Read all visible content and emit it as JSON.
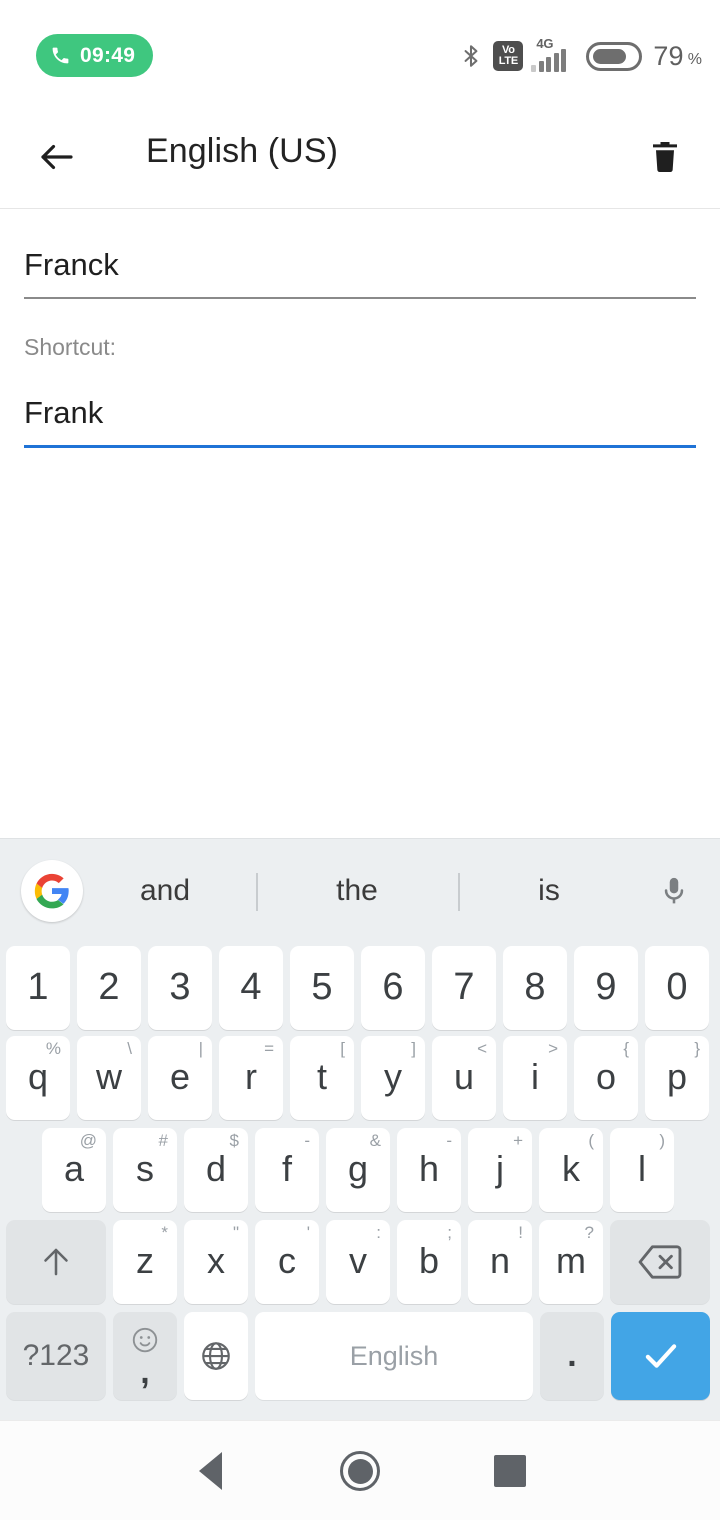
{
  "status_bar": {
    "call_pill": {
      "icon": "phone-icon",
      "time": "09:49",
      "color": "#3fc77f"
    },
    "bluetooth_icon": "bluetooth-icon",
    "volte": {
      "line1": "Vo",
      "line2": "LTE"
    },
    "network": {
      "type": "4G",
      "bars_filled": 4,
      "bars_total": 5
    },
    "battery": {
      "level": "79",
      "unit": "%",
      "fill_percent": 75
    }
  },
  "app_bar": {
    "back_icon": "back-arrow-icon",
    "title": "English (US)",
    "delete_icon": "trash-icon"
  },
  "form": {
    "word": {
      "value": "Franck",
      "focused": false
    },
    "shortcut_label": "Shortcut:",
    "shortcut": {
      "value": "Frank",
      "focused": true
    },
    "focus_color": "#1f73d6",
    "idle_color": "#8a8a8a"
  },
  "keyboard": {
    "suggestions": {
      "logo": "google-g-icon",
      "items": [
        "and",
        "the",
        "is"
      ],
      "mic_icon": "microphone-icon"
    },
    "rows": {
      "numbers": [
        {
          "key": "1"
        },
        {
          "key": "2"
        },
        {
          "key": "3"
        },
        {
          "key": "4"
        },
        {
          "key": "5"
        },
        {
          "key": "6"
        },
        {
          "key": "7"
        },
        {
          "key": "8"
        },
        {
          "key": "9"
        },
        {
          "key": "0"
        }
      ],
      "top": [
        {
          "key": "q",
          "hint": "%"
        },
        {
          "key": "w",
          "hint": "\\"
        },
        {
          "key": "e",
          "hint": "|"
        },
        {
          "key": "r",
          "hint": "="
        },
        {
          "key": "t",
          "hint": "["
        },
        {
          "key": "y",
          "hint": "]"
        },
        {
          "key": "u",
          "hint": "<"
        },
        {
          "key": "i",
          "hint": ">"
        },
        {
          "key": "o",
          "hint": "{"
        },
        {
          "key": "p",
          "hint": "}"
        }
      ],
      "home": [
        {
          "key": "a",
          "hint": "@"
        },
        {
          "key": "s",
          "hint": "#"
        },
        {
          "key": "d",
          "hint": "$"
        },
        {
          "key": "f",
          "hint": "-"
        },
        {
          "key": "g",
          "hint": "&"
        },
        {
          "key": "h",
          "hint": "-"
        },
        {
          "key": "j",
          "hint": "+"
        },
        {
          "key": "k",
          "hint": "("
        },
        {
          "key": "l",
          "hint": ")"
        }
      ],
      "bottom": [
        {
          "key": "z",
          "hint": "*"
        },
        {
          "key": "x",
          "hint": "\""
        },
        {
          "key": "c",
          "hint": "'"
        },
        {
          "key": "v",
          "hint": ":"
        },
        {
          "key": "b",
          "hint": ";"
        },
        {
          "key": "n",
          "hint": "!"
        },
        {
          "key": "m",
          "hint": "?"
        }
      ],
      "shift_icon": "shift-arrow-icon",
      "backspace_icon": "backspace-icon"
    },
    "function_row": {
      "symbols_label": "?123",
      "emoji_icon": "emoji-smiley-icon",
      "comma_label": ",",
      "globe_icon": "globe-language-icon",
      "space_label": "English",
      "period_label": ".",
      "enter_icon": "checkmark-icon",
      "enter_color": "#42a5e6"
    }
  },
  "nav_bar": {
    "back_icon": "nav-back-triangle-icon",
    "home_icon": "nav-home-circle-icon",
    "recents_icon": "nav-recents-square-icon"
  }
}
